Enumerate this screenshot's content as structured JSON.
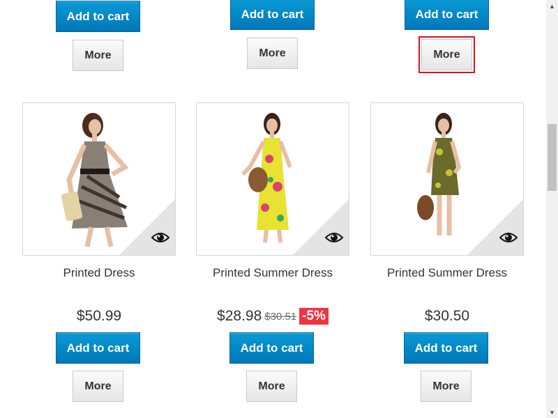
{
  "top_row": [
    {
      "add_label": "Add to cart",
      "more_label": "More"
    },
    {
      "add_label": "Add to cart",
      "more_label": "More"
    },
    {
      "add_label": "Add to cart",
      "more_label": "More"
    }
  ],
  "products": [
    {
      "name": "Printed Dress",
      "price": "$50.99",
      "old_price": "",
      "discount": "",
      "dress_color": "#8a7f74",
      "pattern_color": "#3e3530",
      "add_label": "Add to cart",
      "more_label": "More",
      "icon": "eye-icon"
    },
    {
      "name": "Printed Summer Dress",
      "price": "$28.98",
      "old_price": "$30.51",
      "discount": "-5%",
      "dress_color": "#e8e232",
      "pattern_color": "#d9436e",
      "add_label": "Add to cart",
      "more_label": "More",
      "icon": "eye-icon"
    },
    {
      "name": "Printed Summer Dress",
      "price": "$30.50",
      "old_price": "",
      "discount": "",
      "dress_color": "#6b6a2a",
      "pattern_color": "#c8c23a",
      "add_label": "Add to cart",
      "more_label": "More",
      "icon": "eye-icon"
    }
  ],
  "colors": {
    "accent": "#0077b8",
    "discount": "#f13340",
    "focus_outline": "#e0101b"
  }
}
